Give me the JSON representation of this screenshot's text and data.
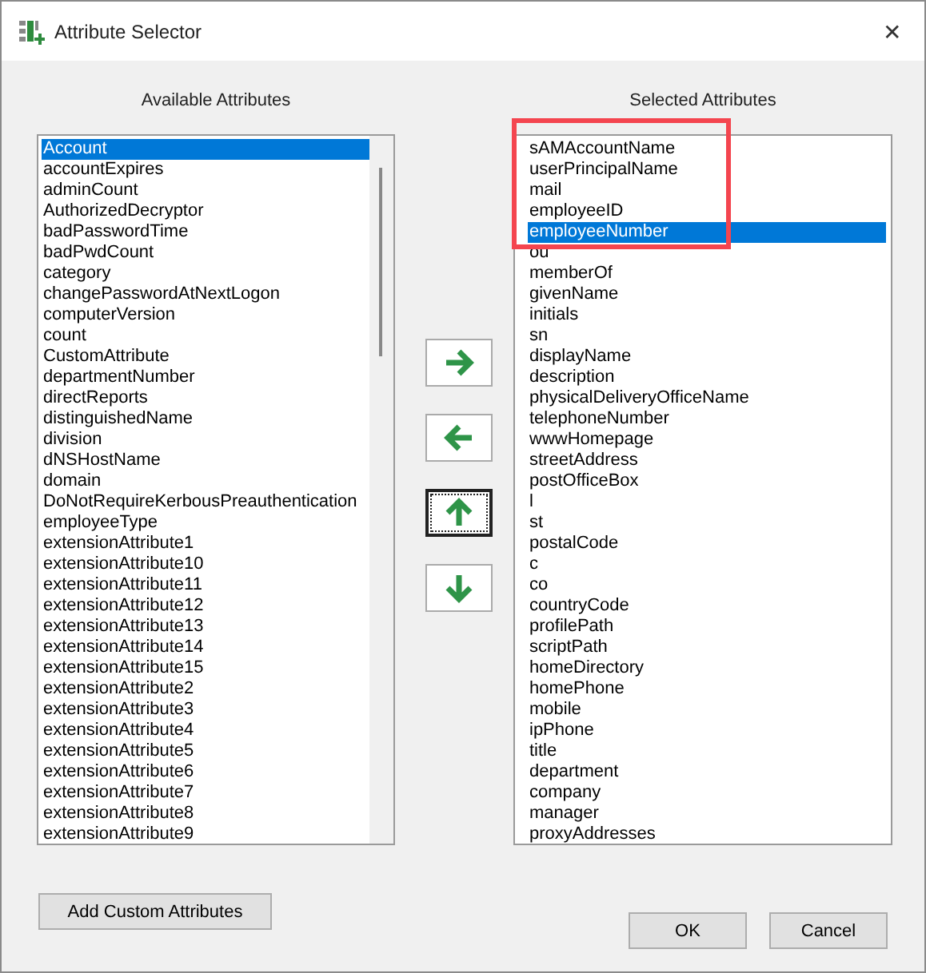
{
  "window": {
    "title": "Attribute Selector",
    "close": "✕"
  },
  "available": {
    "heading": "Available Attributes",
    "items": [
      {
        "label": "Account",
        "selected": true
      },
      {
        "label": "accountExpires",
        "selected": false
      },
      {
        "label": "adminCount",
        "selected": false
      },
      {
        "label": "AuthorizedDecryptor",
        "selected": false
      },
      {
        "label": "badPasswordTime",
        "selected": false
      },
      {
        "label": "badPwdCount",
        "selected": false
      },
      {
        "label": "category",
        "selected": false
      },
      {
        "label": "changePasswordAtNextLogon",
        "selected": false
      },
      {
        "label": "computerVersion",
        "selected": false
      },
      {
        "label": "count",
        "selected": false
      },
      {
        "label": "CustomAttribute",
        "selected": false
      },
      {
        "label": "departmentNumber",
        "selected": false
      },
      {
        "label": "directReports",
        "selected": false
      },
      {
        "label": "distinguishedName",
        "selected": false
      },
      {
        "label": "division",
        "selected": false
      },
      {
        "label": "dNSHostName",
        "selected": false
      },
      {
        "label": "domain",
        "selected": false
      },
      {
        "label": "DoNotRequireKerbousPreauthentication",
        "selected": false
      },
      {
        "label": "employeeType",
        "selected": false
      },
      {
        "label": "extensionAttribute1",
        "selected": false
      },
      {
        "label": "extensionAttribute10",
        "selected": false
      },
      {
        "label": "extensionAttribute11",
        "selected": false
      },
      {
        "label": "extensionAttribute12",
        "selected": false
      },
      {
        "label": "extensionAttribute13",
        "selected": false
      },
      {
        "label": "extensionAttribute14",
        "selected": false
      },
      {
        "label": "extensionAttribute15",
        "selected": false
      },
      {
        "label": "extensionAttribute2",
        "selected": false
      },
      {
        "label": "extensionAttribute3",
        "selected": false
      },
      {
        "label": "extensionAttribute4",
        "selected": false
      },
      {
        "label": "extensionAttribute5",
        "selected": false
      },
      {
        "label": "extensionAttribute6",
        "selected": false
      },
      {
        "label": "extensionAttribute7",
        "selected": false
      },
      {
        "label": "extensionAttribute8",
        "selected": false
      },
      {
        "label": "extensionAttribute9",
        "selected": false
      }
    ]
  },
  "move_buttons": [
    {
      "kind": "right",
      "focused": false
    },
    {
      "kind": "left",
      "focused": false
    },
    {
      "kind": "up",
      "focused": true
    },
    {
      "kind": "down",
      "focused": false
    }
  ],
  "selected_attributes": {
    "heading": "Selected Attributes",
    "highlighted_items": [
      {
        "label": "sAMAccountName",
        "selected": false
      },
      {
        "label": "userPrincipalName",
        "selected": false
      },
      {
        "label": "mail",
        "selected": false
      },
      {
        "label": "employeeID",
        "selected": false
      },
      {
        "label": "employeeNumber",
        "selected": true
      }
    ],
    "items": [
      {
        "label": "ou",
        "selected": false
      },
      {
        "label": "memberOf",
        "selected": false
      },
      {
        "label": "givenName",
        "selected": false
      },
      {
        "label": "initials",
        "selected": false
      },
      {
        "label": "sn",
        "selected": false
      },
      {
        "label": "displayName",
        "selected": false
      },
      {
        "label": "description",
        "selected": false
      },
      {
        "label": "physicalDeliveryOfficeName",
        "selected": false
      },
      {
        "label": "telephoneNumber",
        "selected": false
      },
      {
        "label": "wwwHomepage",
        "selected": false
      },
      {
        "label": "streetAddress",
        "selected": false
      },
      {
        "label": "postOfficeBox",
        "selected": false
      },
      {
        "label": "l",
        "selected": false
      },
      {
        "label": "st",
        "selected": false
      },
      {
        "label": "postalCode",
        "selected": false
      },
      {
        "label": "c",
        "selected": false
      },
      {
        "label": "co",
        "selected": false
      },
      {
        "label": "countryCode",
        "selected": false
      },
      {
        "label": "profilePath",
        "selected": false
      },
      {
        "label": "scriptPath",
        "selected": false
      },
      {
        "label": "homeDirectory",
        "selected": false
      },
      {
        "label": "homePhone",
        "selected": false
      },
      {
        "label": "mobile",
        "selected": false
      },
      {
        "label": "ipPhone",
        "selected": false
      },
      {
        "label": "title",
        "selected": false
      },
      {
        "label": "department",
        "selected": false
      },
      {
        "label": "company",
        "selected": false
      },
      {
        "label": "manager",
        "selected": false
      },
      {
        "label": "proxyAddresses",
        "selected": false
      }
    ]
  },
  "footer": {
    "add_button": "Add Custom Attributes",
    "ok_button": "OK",
    "cancel_button": "Cancel"
  }
}
